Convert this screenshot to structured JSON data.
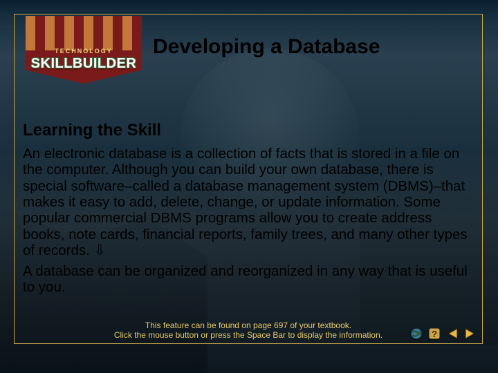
{
  "logo": {
    "eyebrow": "TECHNOLOGY",
    "title": "SKILLBUILDER"
  },
  "title": "Developing a Database",
  "subhead": "Learning the Skill",
  "paragraph1": "An electronic database is a collection of facts that is stored in a file on the computer. Although you can build your own database, there is special software–called a database management system (DBMS)–that makes it easy to add, delete, change, or update information. Some popular commercial DBMS programs allow you to create address books, note cards, financial reports, family trees, and many other types of records. ⇩",
  "paragraph2": "A database can be organized and reorganized in any way that is useful to you.",
  "footer": {
    "line1": "This feature can be found on page 697 of your textbook.",
    "line2": "Click the mouse button or press the Space Bar to display the information."
  },
  "nav": {
    "globe": "globe-icon",
    "help": "help-icon",
    "prev": "prev-icon",
    "next": "next-icon"
  }
}
